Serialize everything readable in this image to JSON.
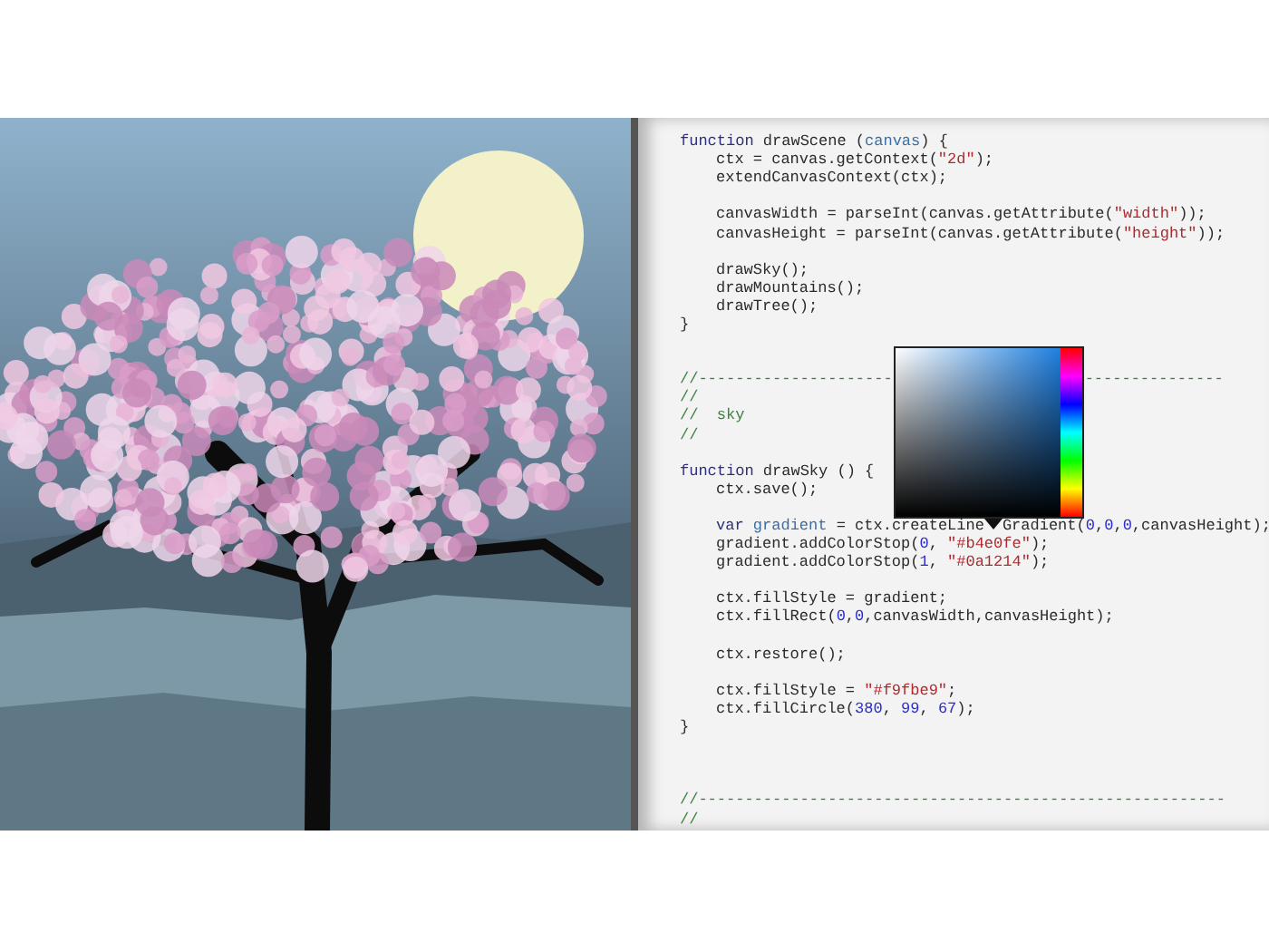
{
  "code_lines": [
    {
      "kind": "code",
      "indented": false,
      "tokens": [
        {
          "text": "function",
          "kind": "keyword"
        },
        {
          "text": " drawScene (",
          "kind": "plain"
        },
        {
          "text": "canvas",
          "kind": "param"
        },
        {
          "text": ") {",
          "kind": "plain"
        }
      ]
    },
    {
      "kind": "code",
      "indented": true,
      "tokens": [
        {
          "text": "ctx = canvas.getContext(",
          "kind": "plain"
        },
        {
          "text": "\"2d\"",
          "kind": "string"
        },
        {
          "text": ");",
          "kind": "plain"
        }
      ]
    },
    {
      "kind": "code",
      "indented": true,
      "tokens": [
        {
          "text": "extendCanvasContext(ctx);",
          "kind": "plain"
        }
      ]
    },
    {
      "kind": "blank"
    },
    {
      "kind": "code",
      "indented": true,
      "tokens": [
        {
          "text": "canvasWidth = parseInt(canvas.getAttribute(",
          "kind": "plain"
        },
        {
          "text": "\"width\"",
          "kind": "string"
        },
        {
          "text": "));",
          "kind": "plain"
        }
      ]
    },
    {
      "kind": "code",
      "indented": true,
      "tokens": [
        {
          "text": "canvasHeight = parseInt(canvas.getAttribute(",
          "kind": "plain"
        },
        {
          "text": "\"height\"",
          "kind": "string"
        },
        {
          "text": "));",
          "kind": "plain"
        }
      ]
    },
    {
      "kind": "blank"
    },
    {
      "kind": "code",
      "indented": true,
      "tokens": [
        {
          "text": "drawSky();",
          "kind": "plain"
        }
      ]
    },
    {
      "kind": "code",
      "indented": true,
      "tokens": [
        {
          "text": "drawMountains();",
          "kind": "plain"
        }
      ]
    },
    {
      "kind": "code",
      "indented": true,
      "tokens": [
        {
          "text": "drawTree();",
          "kind": "plain"
        }
      ]
    },
    {
      "kind": "code",
      "indented": false,
      "tokens": [
        {
          "text": "}",
          "kind": "plain"
        }
      ]
    },
    {
      "kind": "blank"
    },
    {
      "kind": "blank"
    },
    {
      "kind": "code",
      "indented": false,
      "tokens": [
        {
          "text": "//---------------------",
          "kind": "comment"
        },
        {
          "kind": "picker-gap"
        },
        {
          "text": "---------------",
          "kind": "comment"
        }
      ]
    },
    {
      "kind": "code",
      "indented": false,
      "tokens": [
        {
          "text": "//",
          "kind": "comment"
        }
      ]
    },
    {
      "kind": "code",
      "indented": false,
      "tokens": [
        {
          "text": "//  sky",
          "kind": "comment"
        }
      ]
    },
    {
      "kind": "code",
      "indented": false,
      "tokens": [
        {
          "text": "//",
          "kind": "comment"
        }
      ]
    },
    {
      "kind": "blank"
    },
    {
      "kind": "code",
      "indented": false,
      "tokens": [
        {
          "text": "function",
          "kind": "keyword"
        },
        {
          "text": " drawSky () {",
          "kind": "plain"
        }
      ]
    },
    {
      "kind": "code",
      "indented": true,
      "tokens": [
        {
          "text": "ctx.save();",
          "kind": "plain"
        }
      ]
    },
    {
      "kind": "blank"
    },
    {
      "kind": "code",
      "indented": true,
      "tokens": [
        {
          "text": "var",
          "kind": "keyword"
        },
        {
          "text": " gradient",
          "kind": "param"
        },
        {
          "text": " = ctx.createLine",
          "kind": "plain"
        },
        {
          "kind": "pointer-gap"
        },
        {
          "text": "Gradient(",
          "kind": "plain"
        },
        {
          "text": "0",
          "kind": "number"
        },
        {
          "text": ",",
          "kind": "plain"
        },
        {
          "text": "0",
          "kind": "number"
        },
        {
          "text": ",",
          "kind": "plain"
        },
        {
          "text": "0",
          "kind": "number"
        },
        {
          "text": ",canvasHeight);",
          "kind": "plain"
        }
      ]
    },
    {
      "kind": "code",
      "indented": true,
      "tokens": [
        {
          "text": "gradient.addColorStop(",
          "kind": "plain"
        },
        {
          "text": "0",
          "kind": "number"
        },
        {
          "text": ", ",
          "kind": "plain"
        },
        {
          "text": "\"#b4e0fe\"",
          "kind": "string"
        },
        {
          "text": ");",
          "kind": "plain"
        }
      ]
    },
    {
      "kind": "code",
      "indented": true,
      "tokens": [
        {
          "text": "gradient.addColorStop(",
          "kind": "plain"
        },
        {
          "text": "1",
          "kind": "number"
        },
        {
          "text": ", ",
          "kind": "plain"
        },
        {
          "text": "\"#0a1214\"",
          "kind": "string"
        },
        {
          "text": ");",
          "kind": "plain"
        }
      ]
    },
    {
      "kind": "blank"
    },
    {
      "kind": "code",
      "indented": true,
      "tokens": [
        {
          "text": "ctx.fillStyle = gradient;",
          "kind": "plain"
        }
      ]
    },
    {
      "kind": "code",
      "indented": true,
      "tokens": [
        {
          "text": "ctx.fillRect(",
          "kind": "plain"
        },
        {
          "text": "0",
          "kind": "number"
        },
        {
          "text": ",",
          "kind": "plain"
        },
        {
          "text": "0",
          "kind": "number"
        },
        {
          "text": ",canvasWidth,canvasHeight);",
          "kind": "plain"
        }
      ]
    },
    {
      "kind": "blank"
    },
    {
      "kind": "code",
      "indented": true,
      "tokens": [
        {
          "text": "ctx.restore();",
          "kind": "plain"
        }
      ]
    },
    {
      "kind": "blank"
    },
    {
      "kind": "code",
      "indented": true,
      "tokens": [
        {
          "text": "ctx.fillStyle = ",
          "kind": "plain"
        },
        {
          "text": "\"#f9fbe9\"",
          "kind": "string"
        },
        {
          "text": ";",
          "kind": "plain"
        }
      ]
    },
    {
      "kind": "code",
      "indented": true,
      "tokens": [
        {
          "text": "ctx.fillCircle(",
          "kind": "plain"
        },
        {
          "text": "380",
          "kind": "number"
        },
        {
          "text": ", ",
          "kind": "plain"
        },
        {
          "text": "99",
          "kind": "number"
        },
        {
          "text": ", ",
          "kind": "plain"
        },
        {
          "text": "67",
          "kind": "number"
        },
        {
          "text": ");",
          "kind": "plain"
        }
      ]
    },
    {
      "kind": "code",
      "indented": false,
      "tokens": [
        {
          "text": "}",
          "kind": "plain"
        }
      ]
    },
    {
      "kind": "blank"
    },
    {
      "kind": "blank"
    },
    {
      "kind": "blank"
    },
    {
      "kind": "code",
      "indented": false,
      "tokens": [
        {
          "text": "//---------------------------------------------------------",
          "kind": "comment"
        }
      ]
    },
    {
      "kind": "code",
      "indented": false,
      "tokens": [
        {
          "text": "//",
          "kind": "comment"
        }
      ]
    }
  ]
}
